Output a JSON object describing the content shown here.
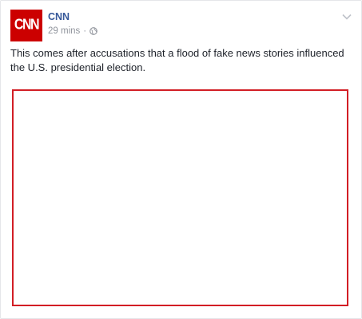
{
  "post": {
    "page_name": "CNN",
    "avatar_text": "CNN",
    "timestamp": "29 mins",
    "separator": "·",
    "privacy_icon": "globe-icon",
    "menu_icon": "chevron-down-icon",
    "text": "This comes after accusations that a flood of fake news stories influenced the U.S. presidential election."
  },
  "colors": {
    "brand_red": "#cc0000",
    "link_blue": "#365899",
    "meta_gray": "#90949c",
    "frame_red": "#d21e25"
  }
}
